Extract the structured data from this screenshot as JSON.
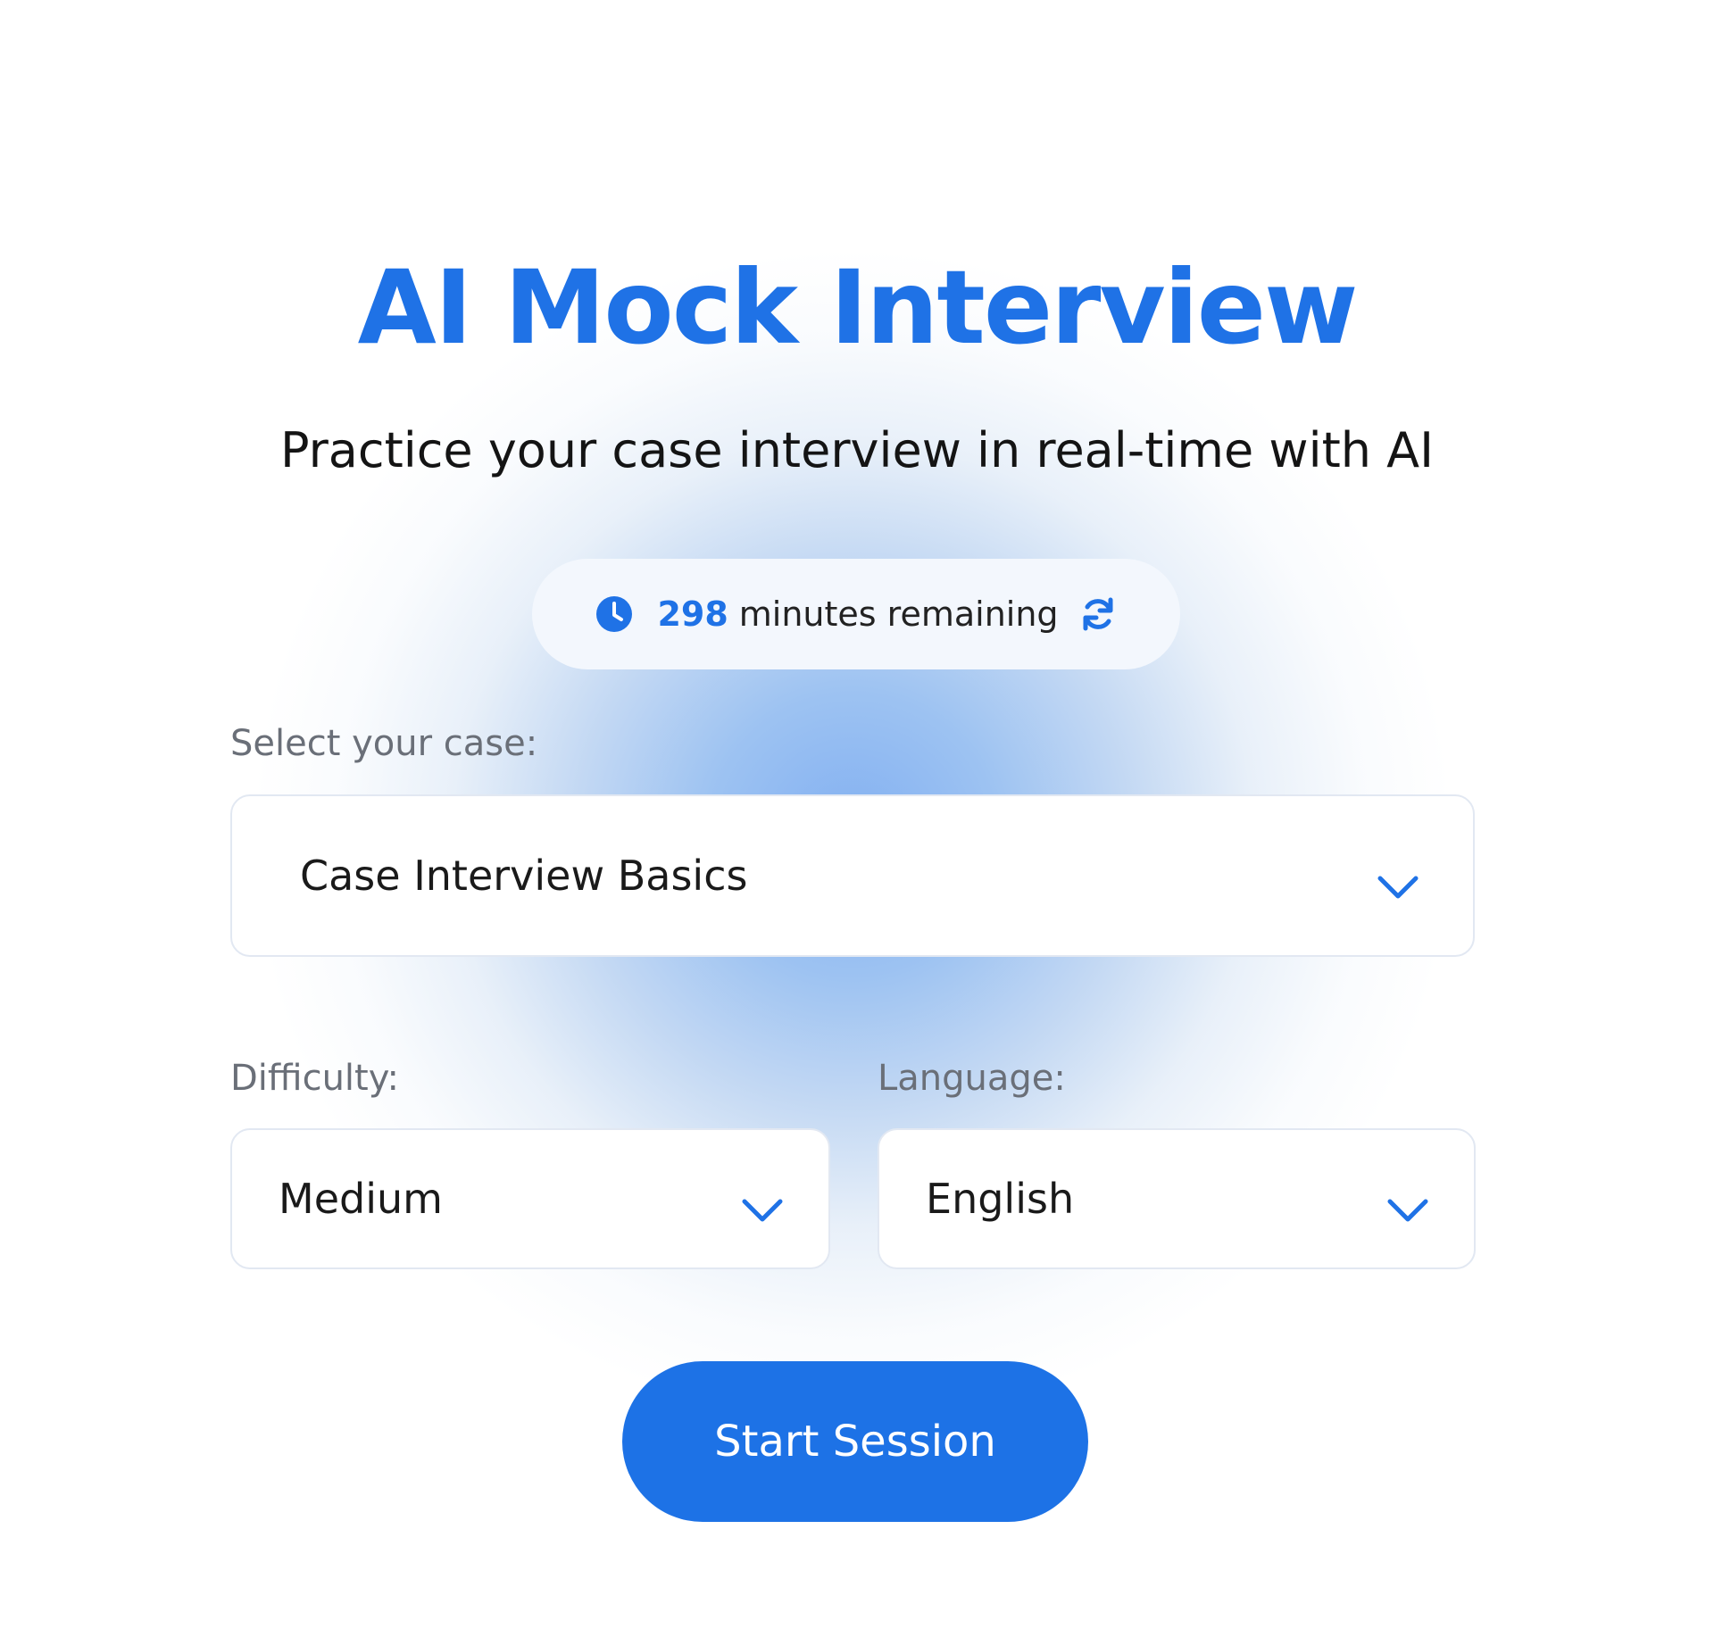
{
  "header": {
    "title": "AI Mock Interview",
    "subtitle": "Practice your case interview in real-time with AI"
  },
  "minutes": {
    "count": "298",
    "label": "minutes remaining",
    "icon_left": "clock-icon",
    "icon_right": "refresh-icon"
  },
  "case": {
    "label": "Select your case:",
    "value": "Case Interview Basics"
  },
  "difficulty": {
    "label": "Difficulty:",
    "value": "Medium"
  },
  "language": {
    "label": "Language:",
    "value": "English"
  },
  "actions": {
    "start_label": "Start Session"
  },
  "colors": {
    "accent": "#1f72e6",
    "button": "#1d72e6",
    "text": "#141414",
    "label": "#6a6f78",
    "pill_bg": "#f3f7fd"
  }
}
